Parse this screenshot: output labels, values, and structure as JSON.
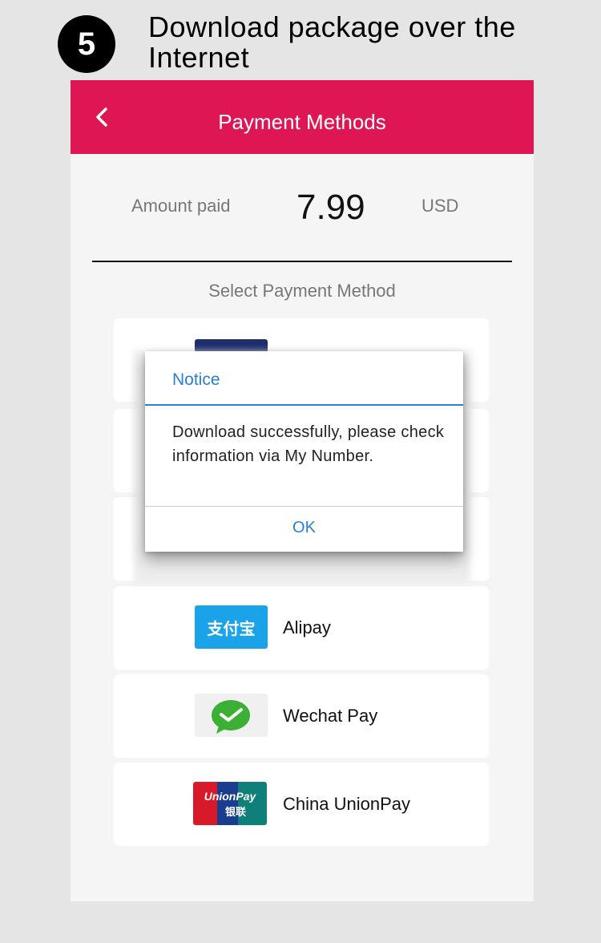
{
  "step": {
    "number": "5",
    "title": "Download package over the Internet"
  },
  "header": {
    "title": "Payment Methods",
    "back_icon": "chevron-left-icon",
    "color": "#de1754"
  },
  "amount": {
    "label": "Amount paid",
    "value": "7.99",
    "currency": "USD"
  },
  "select_label": "Select Payment Method",
  "payment_methods": [
    {
      "label": "",
      "icon": "card-logo-icon"
    },
    {
      "label": "",
      "icon": "card-logo-icon"
    },
    {
      "label": "",
      "icon": "card-logo-icon"
    },
    {
      "label": "Alipay",
      "icon": "alipay-icon",
      "logo_text": "支付宝"
    },
    {
      "label": "Wechat Pay",
      "icon": "wechat-pay-icon"
    },
    {
      "label": "China UnionPay",
      "icon": "unionpay-icon",
      "logo_text": "UnionPay",
      "logo_subtext": "银联"
    }
  ],
  "dialog": {
    "title": "Notice",
    "message": "Download successfully, please check information via My Number.",
    "ok_label": "OK",
    "accent": "#2a7fd4"
  }
}
